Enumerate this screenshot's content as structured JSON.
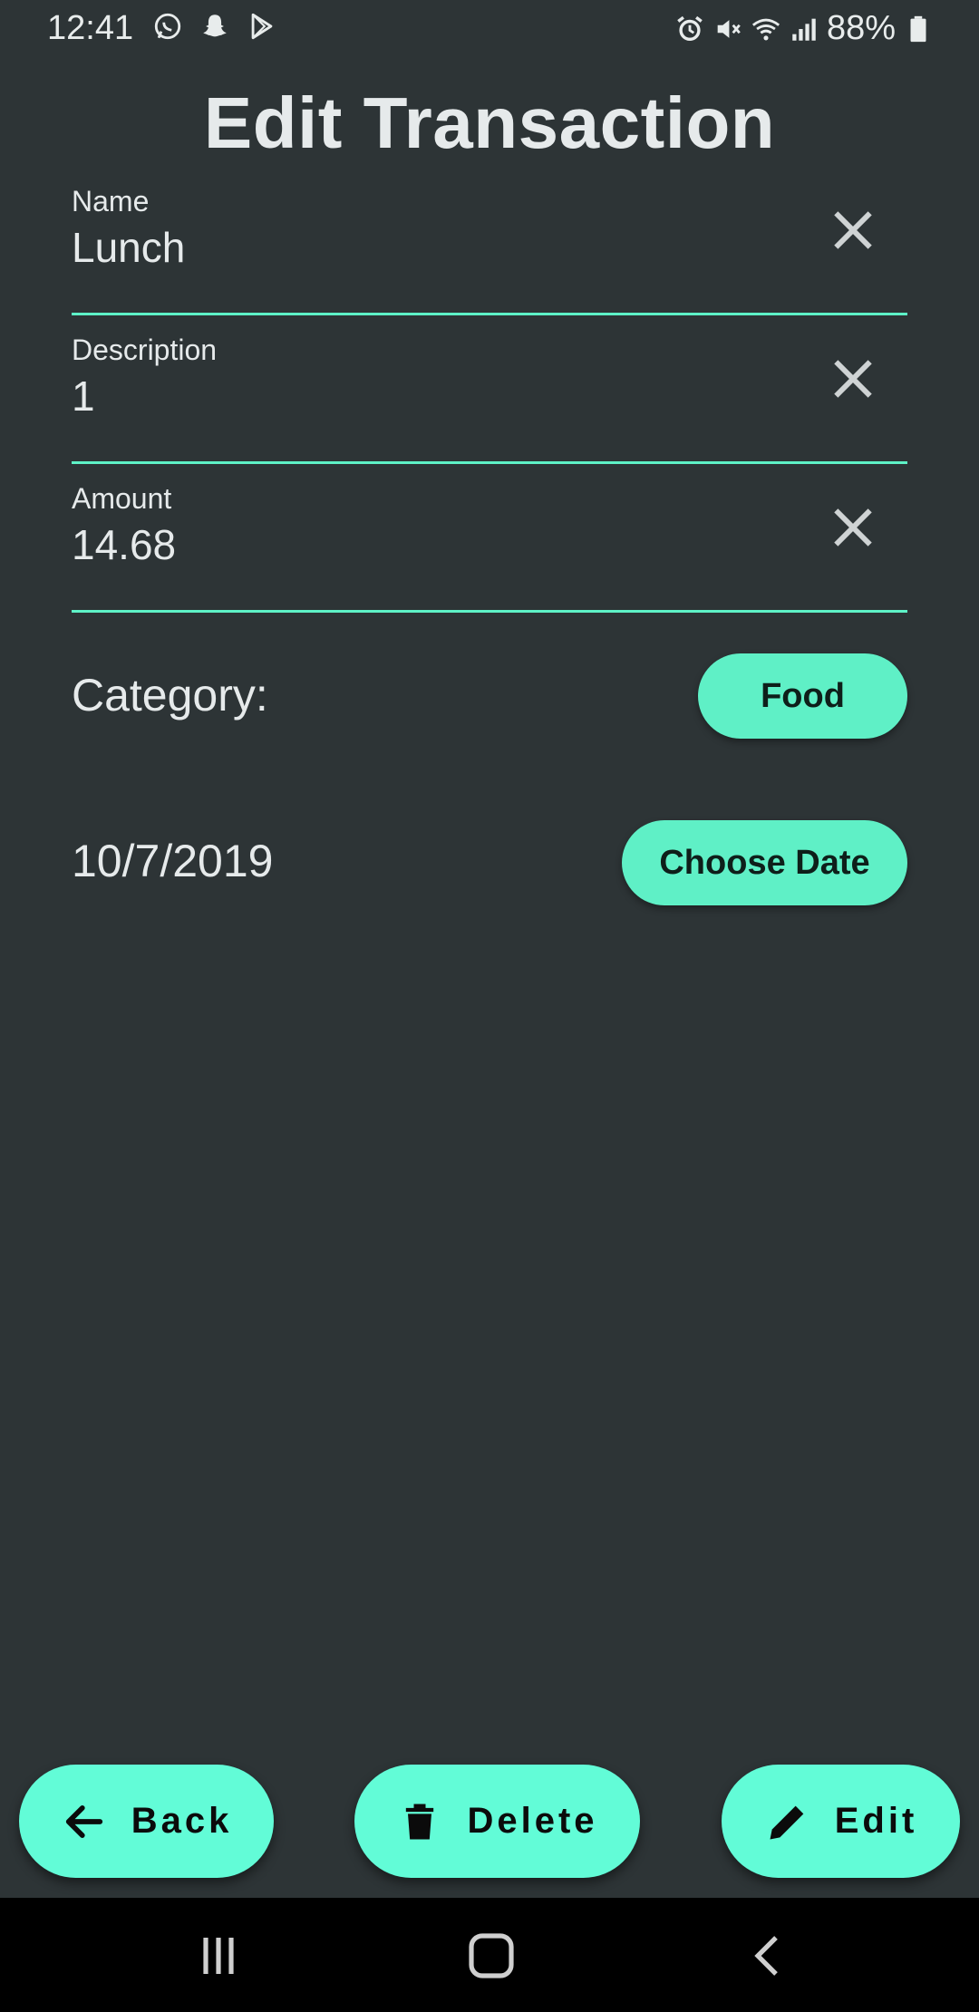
{
  "status_bar": {
    "time": "12:41",
    "battery": "88%",
    "left_icons": [
      "whatsapp-icon",
      "snapchat-icon",
      "play-store-icon"
    ],
    "right_icons": [
      "alarm-icon",
      "mute-icon",
      "wifi-icon",
      "signal-icon",
      "battery-icon"
    ]
  },
  "title": "Edit Transaction",
  "fields": [
    {
      "label": "Name",
      "value": "Lunch"
    },
    {
      "label": "Description",
      "value": "1"
    },
    {
      "label": "Amount",
      "value": "14.68"
    }
  ],
  "category": {
    "label": "Category:",
    "button": "Food"
  },
  "date": {
    "value": "10/7/2019",
    "button": "Choose Date"
  },
  "actions": {
    "back": "Back",
    "delete": "Delete",
    "edit": "Edit"
  },
  "colors": {
    "background": "#2d3436",
    "accent": "#5ef2c7",
    "fab": "#62fcd7",
    "nav_bar": "#000000"
  },
  "nav_bar": {
    "icons": [
      "recent-apps-icon",
      "home-icon",
      "back-icon"
    ]
  }
}
